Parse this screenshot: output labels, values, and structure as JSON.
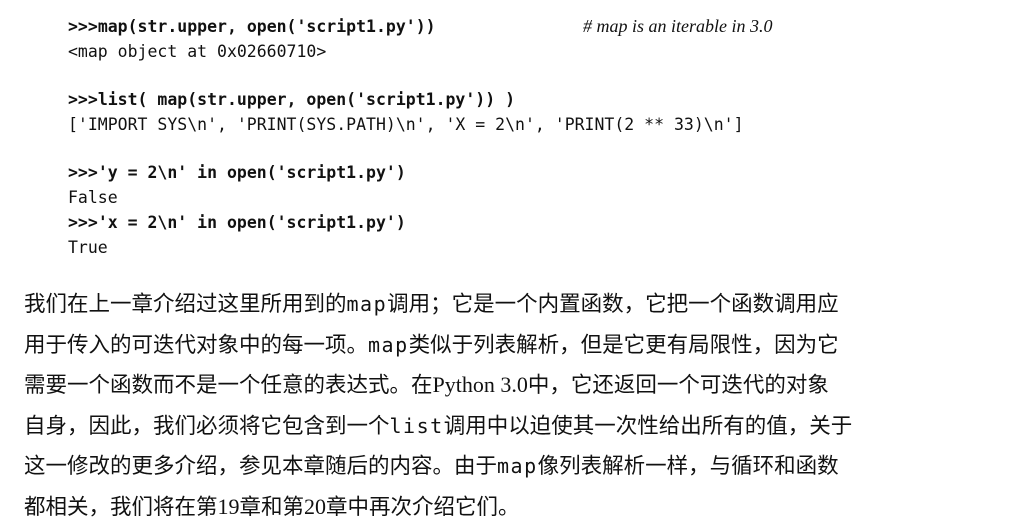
{
  "code": {
    "line1_prompt": ">>>",
    "line1_input": "map(str.upper, open('script1.py'))",
    "line1_comment": "# map is an iterable in 3.0",
    "line2_output": "<map object at 0x02660710>",
    "line3_prompt": ">>>",
    "line3_input": "list( map(str.upper, open('script1.py')) )",
    "line4_output": "['IMPORT SYS\\n', 'PRINT(SYS.PATH)\\n', 'X = 2\\n', 'PRINT(2 ** 33)\\n']",
    "line5_prompt": ">>>",
    "line5_input": "'y = 2\\n' in open('script1.py')",
    "line6_output": "False",
    "line7_prompt": ">>>",
    "line7_input": "'x = 2\\n' in open('script1.py')",
    "line8_output": "True"
  },
  "paragraph": {
    "l1_a": "我们在上一章介绍过这里所用到的",
    "l1_code": "map",
    "l1_b": "调用；它是一个内置函数，它把一个函数调用应",
    "l2_a": "用于传入的可迭代对象中的每一项。",
    "l2_code": "map",
    "l2_b": "类似于列表解析，但是它更有局限性，因为它",
    "l3_a": "需要一个函数而不是一个任意的表达式。在",
    "l3_latin": "Python 3.0",
    "l3_b": "中，它还返回一个可迭代的对象",
    "l4_a": "自身，因此，我们必须将它包含到一个",
    "l4_code": "list",
    "l4_b": "调用中以迫使其一次性给出所有的值，关于",
    "l5_a": "这一修改的更多介绍，参见本章随后的内容。由于",
    "l5_code": "map",
    "l5_b": "像列表解析一样，与循环和函数",
    "l6_a": "都相关，我们将在第",
    "l6_num1": "19",
    "l6_b": "章和第",
    "l6_num2": "20",
    "l6_c": "章中再次介绍它们。"
  }
}
